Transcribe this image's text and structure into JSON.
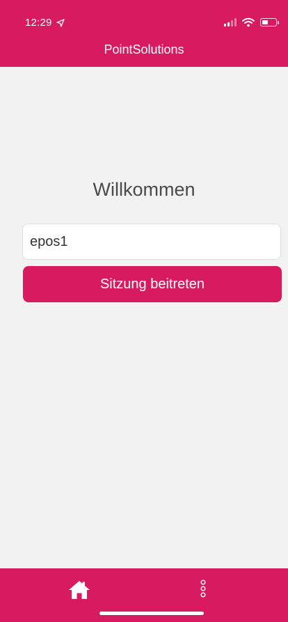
{
  "status_bar": {
    "time": "12:29"
  },
  "header": {
    "title": "PointSolutions"
  },
  "main": {
    "welcome": "Willkommen",
    "session_input_value": "epos1",
    "join_button_label": "Sitzung beitreten"
  },
  "colors": {
    "accent": "#d81b60",
    "background": "#f3f2f3"
  },
  "tabbar": {
    "items": [
      {
        "icon": "home-icon"
      },
      {
        "icon": "more-vertical-icon"
      }
    ]
  }
}
